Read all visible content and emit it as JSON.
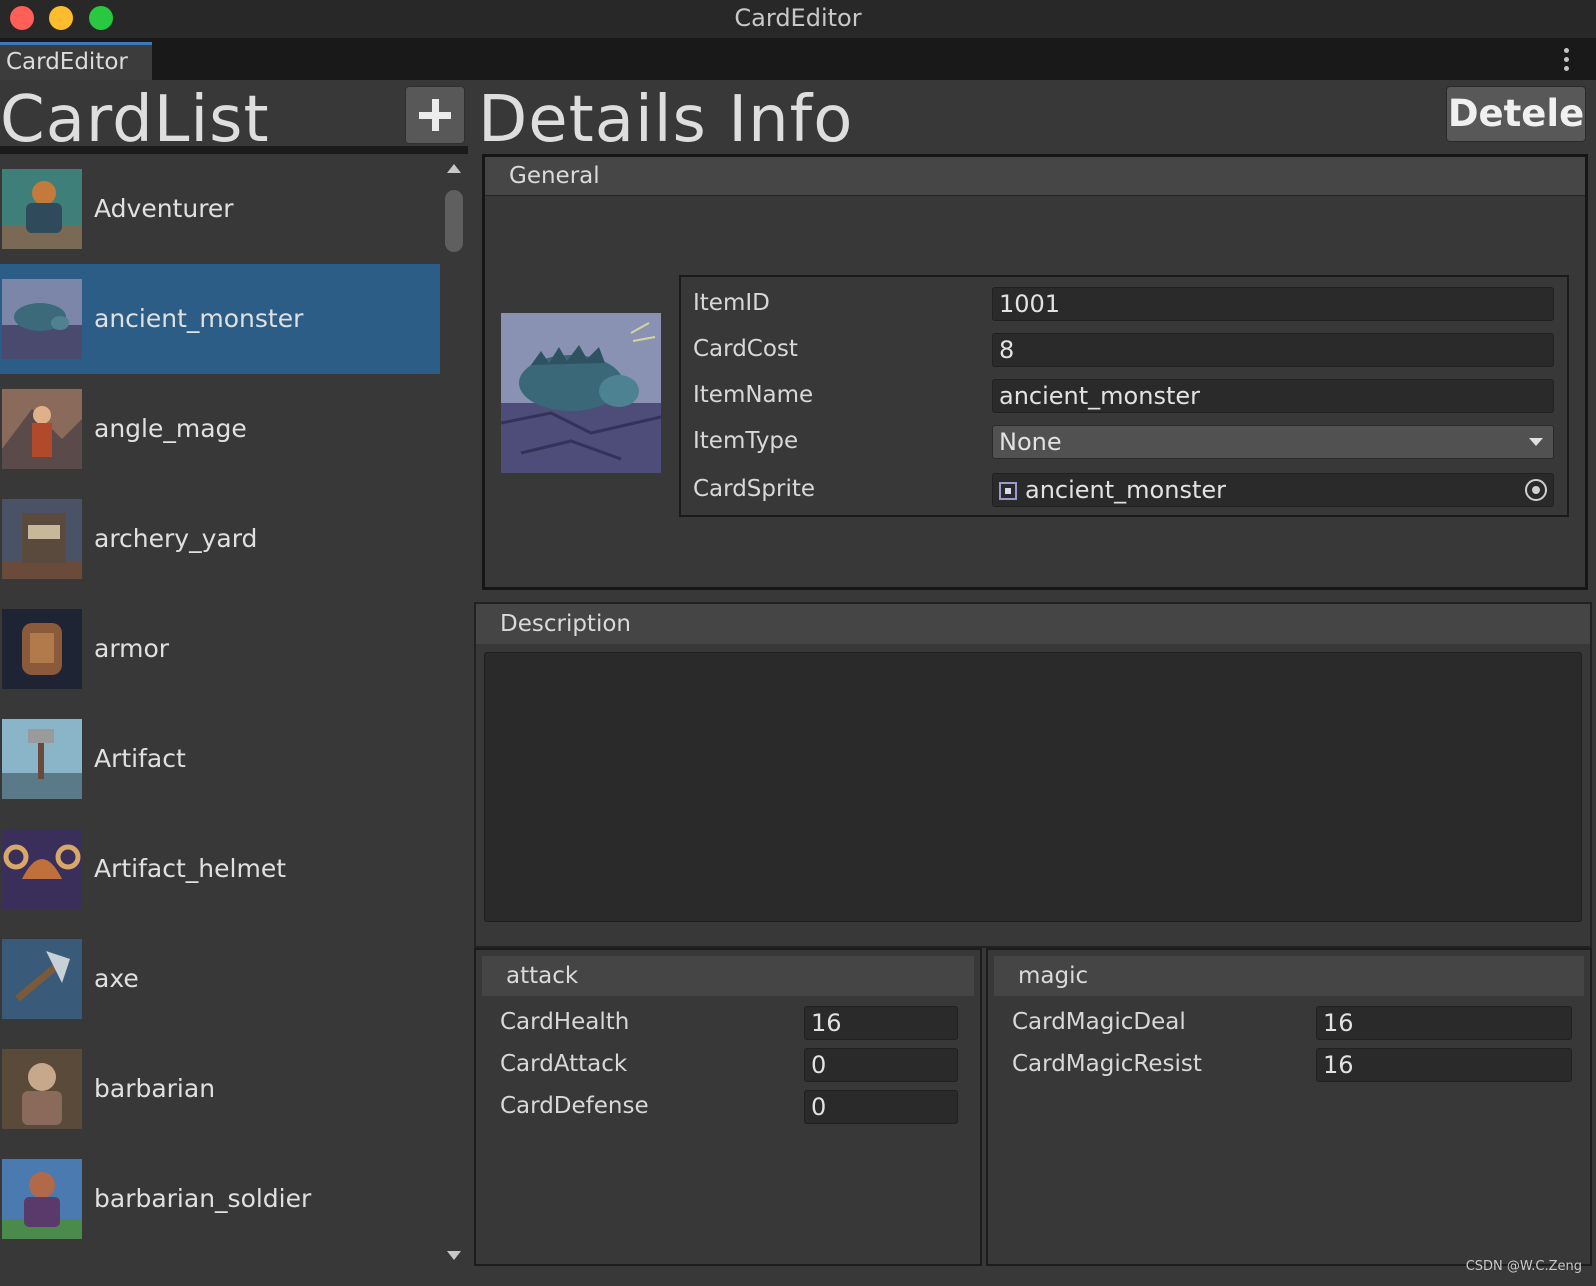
{
  "window": {
    "title": "CardEditor"
  },
  "tab": {
    "label": "CardEditor"
  },
  "cardlist": {
    "title": "CardList",
    "add_label": "+",
    "items": [
      {
        "label": "Adventurer",
        "selected": false
      },
      {
        "label": "ancient_monster",
        "selected": true
      },
      {
        "label": "angle_mage",
        "selected": false
      },
      {
        "label": "archery_yard",
        "selected": false
      },
      {
        "label": "armor",
        "selected": false
      },
      {
        "label": "Artifact",
        "selected": false
      },
      {
        "label": "Artifact_helmet",
        "selected": false
      },
      {
        "label": "axe",
        "selected": false
      },
      {
        "label": "barbarian",
        "selected": false
      },
      {
        "label": "barbarian_soldier",
        "selected": false
      }
    ]
  },
  "details": {
    "title": "Details Info",
    "delete_label": "Detele",
    "general": {
      "header": "General",
      "fields": [
        {
          "label": "ItemID",
          "value": "1001"
        },
        {
          "label": "CardCost",
          "value": "8"
        },
        {
          "label": "ItemName",
          "value": "ancient_monster"
        },
        {
          "label": "ItemType",
          "value": "None"
        },
        {
          "label": "CardSprite",
          "value": "ancient_monster"
        }
      ]
    },
    "description": {
      "header": "Description",
      "value": ""
    },
    "attack": {
      "header": "attack",
      "fields": [
        {
          "label": "CardHealth",
          "value": "16"
        },
        {
          "label": "CardAttack",
          "value": "0"
        },
        {
          "label": "CardDefense",
          "value": "0"
        }
      ]
    },
    "magic": {
      "header": "magic",
      "fields": [
        {
          "label": "CardMagicDeal",
          "value": "16"
        },
        {
          "label": "CardMagicResist",
          "value": "16"
        }
      ]
    }
  },
  "watermark": "CSDN @W.C.Zeng",
  "colors": {
    "selection": "#2c5d87",
    "tab_accent": "#3a79bb",
    "traffic_red": "#fe5f57",
    "traffic_yellow": "#febc2e",
    "traffic_green": "#28c840"
  }
}
